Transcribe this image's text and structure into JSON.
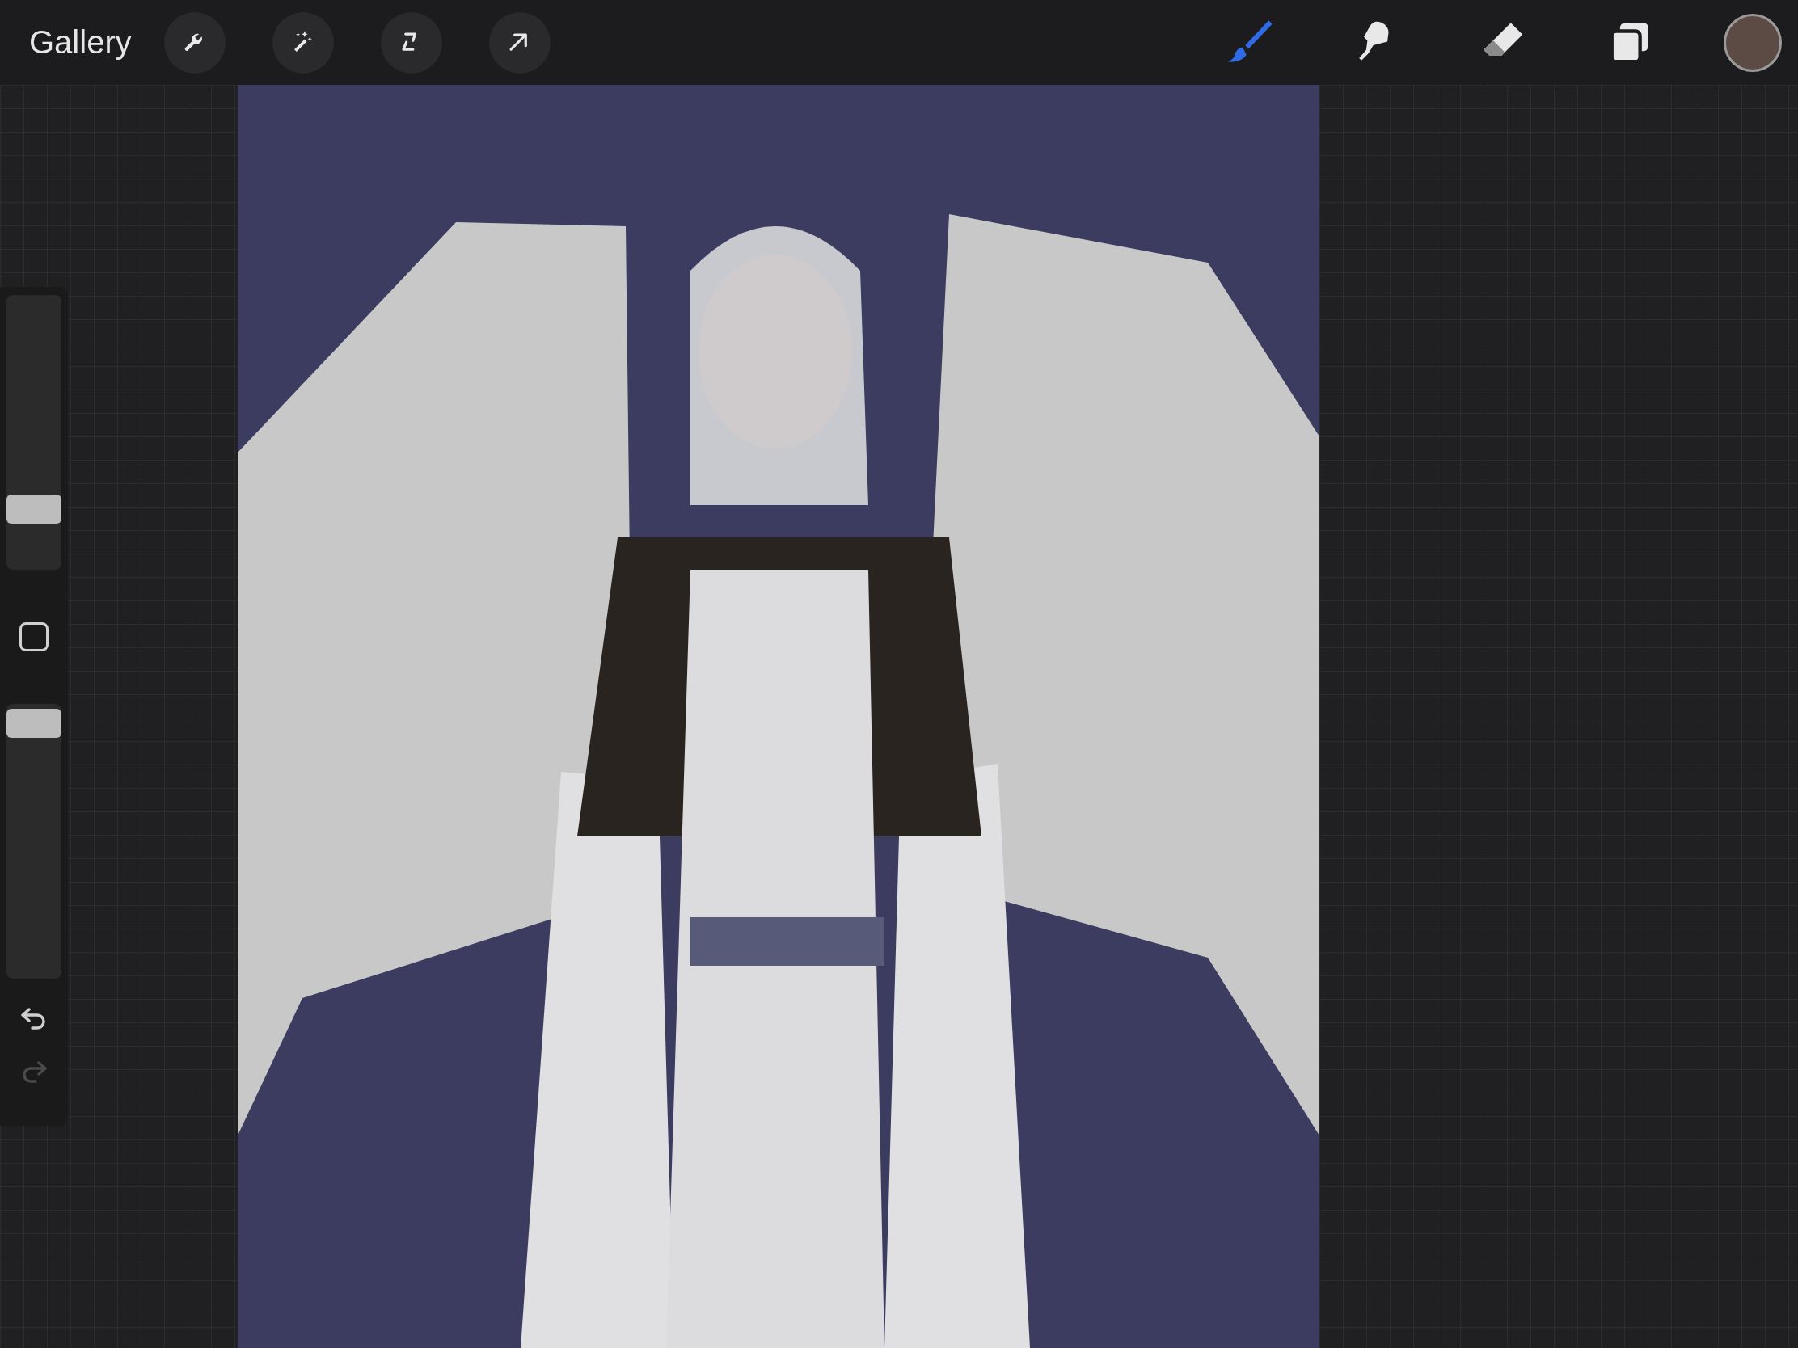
{
  "toolbar": {
    "gallery": "Gallery",
    "left_tools": [
      {
        "kind": "wrench"
      },
      {
        "kind": "wand"
      },
      {
        "kind": "selection"
      },
      {
        "kind": "transform"
      }
    ],
    "right_tools": [
      {
        "kind": "brush",
        "selected": true
      },
      {
        "kind": "smudge",
        "selected": false
      },
      {
        "kind": "eraser",
        "selected": false
      },
      {
        "kind": "layers",
        "selected": false
      }
    ],
    "color_swatch": {
      "color": "#5c4b45"
    }
  },
  "sidebar": {
    "sliders": [
      {
        "level": 0.22
      },
      {
        "level": 0.93
      }
    ],
    "undo": {
      "disabled": false
    },
    "redo": {
      "disabled": true
    }
  }
}
